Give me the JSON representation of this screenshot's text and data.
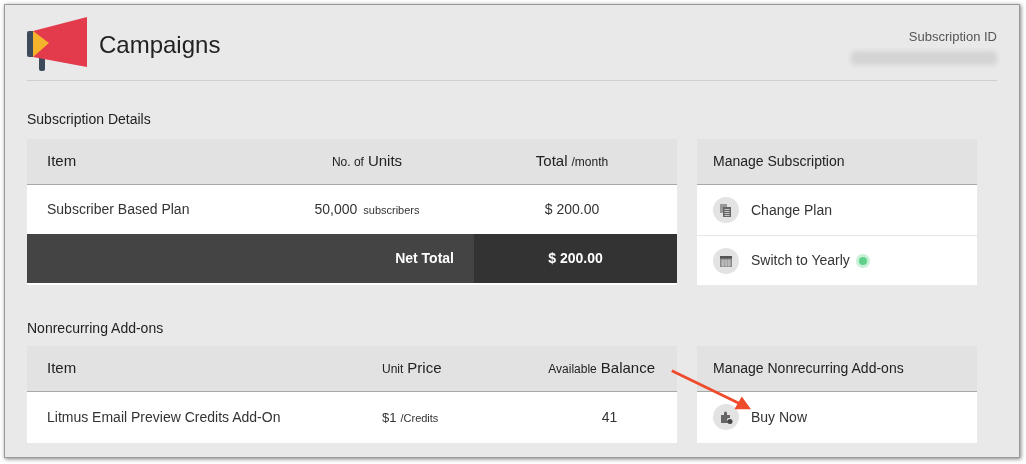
{
  "header": {
    "title": "Campaigns",
    "subscription_id_label": "Subscription ID"
  },
  "subscription": {
    "heading": "Subscription Details",
    "columns": [
      {
        "label": "Item"
      },
      {
        "prefix": "No. of",
        "label": "Units"
      },
      {
        "label": "Total",
        "suffix": "/month"
      }
    ],
    "rows": [
      {
        "item": "Subscriber Based Plan",
        "units": "50,000",
        "units_suffix": "subscribers",
        "total": "$ 200.00"
      }
    ],
    "net_total": {
      "label": "Net Total",
      "value": "$ 200.00"
    },
    "manage": {
      "title": "Manage Subscription",
      "items": [
        {
          "kind": "document",
          "label": "Change Plan",
          "badge": false
        },
        {
          "kind": "calendar",
          "label": "Switch to Yearly",
          "badge": true
        }
      ]
    }
  },
  "addons": {
    "heading": "Nonrecurring Add-ons",
    "columns": [
      {
        "label": "Item"
      },
      {
        "prefix": "Unit",
        "label": "Price"
      },
      {
        "prefix": "Available",
        "label": "Balance"
      }
    ],
    "rows": [
      {
        "item": "Litmus Email Preview Credits Add-On",
        "price": "$1",
        "price_suffix": "/Credits",
        "balance": "41"
      }
    ],
    "manage": {
      "title": "Manage Nonrecurring Add-ons",
      "items": [
        {
          "kind": "puzzle",
          "label": "Buy Now",
          "badge": false
        }
      ]
    }
  }
}
